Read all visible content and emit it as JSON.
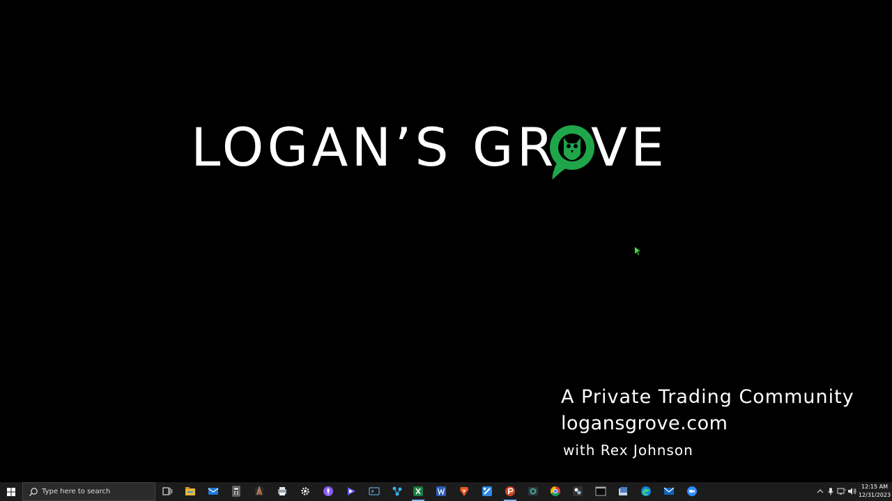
{
  "slide": {
    "logo_left": "LOGAN’S GR",
    "logo_right": "VE",
    "tagline_line1": "A Private Trading Community",
    "tagline_line2": "logansgrove.com",
    "tagline_line3": "with Rex Johnson"
  },
  "colors": {
    "brand_green": "#1fa64a",
    "background": "#000000",
    "taskbar": "#1c1c1c"
  },
  "taskbar": {
    "search_placeholder": "Type here to search",
    "apps": [
      {
        "name": "task-view-icon"
      },
      {
        "name": "file-explorer-icon"
      },
      {
        "name": "mail-icon"
      },
      {
        "name": "calculator-icon"
      },
      {
        "name": "app-icon"
      },
      {
        "name": "app-icon"
      },
      {
        "name": "settings-icon"
      },
      {
        "name": "podcast-icon"
      },
      {
        "name": "media-icon"
      },
      {
        "name": "screen-icon"
      },
      {
        "name": "network-icon"
      },
      {
        "name": "excel-icon"
      },
      {
        "name": "word-icon"
      },
      {
        "name": "brave-icon"
      },
      {
        "name": "app-icon"
      },
      {
        "name": "powerpoint-icon"
      },
      {
        "name": "app-icon"
      },
      {
        "name": "chrome-icon"
      },
      {
        "name": "app-icon"
      },
      {
        "name": "terminal-icon"
      },
      {
        "name": "app-icon"
      },
      {
        "name": "edge-icon"
      },
      {
        "name": "mail-icon"
      },
      {
        "name": "zoom-icon"
      }
    ],
    "clock_time": "12:15 AM",
    "clock_date": "12/31/2023"
  }
}
